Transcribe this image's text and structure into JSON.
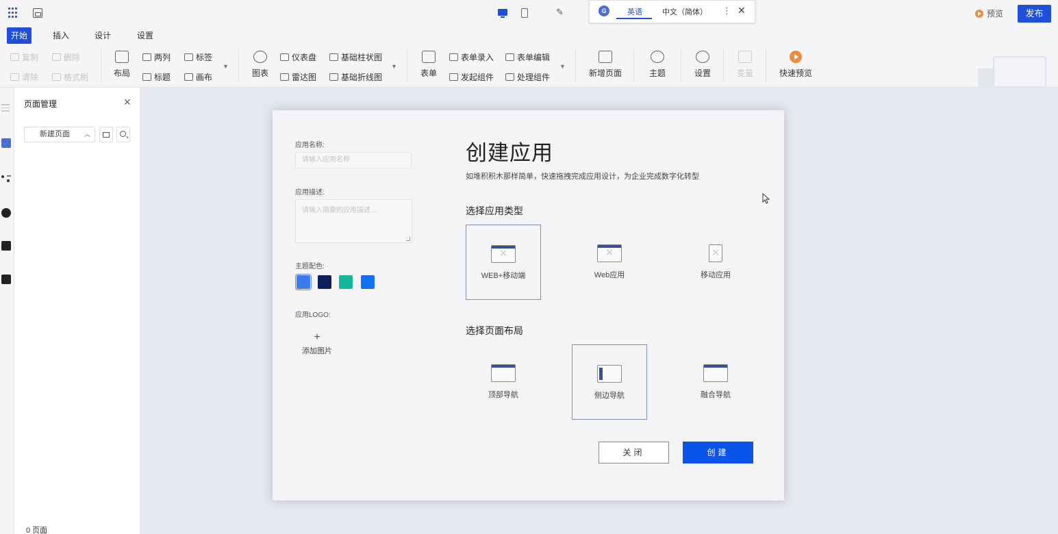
{
  "topbar": {
    "translate": {
      "lang_active": "英语",
      "lang_other": "中文（简体）"
    },
    "preview_label": "预览",
    "publish_label": "发布"
  },
  "menu_tabs": [
    {
      "label": "开始",
      "active": true
    },
    {
      "label": "插入"
    },
    {
      "label": "设计"
    },
    {
      "label": "设置"
    }
  ],
  "ribbon": {
    "edit": {
      "copy": "复制",
      "delete": "删除",
      "clear": "清除",
      "format": "格式刷"
    },
    "layout": {
      "big": "布局",
      "two_col": "两列",
      "tag": "标签",
      "title": "标题",
      "canvas": "画布"
    },
    "charts": {
      "big": "图表",
      "gauge": "仪表盘",
      "bar": "基础柱状图",
      "radar": "雷达图",
      "line": "基础折线图"
    },
    "forms": {
      "big": "表单",
      "entry": "表单录入",
      "edit": "表单编辑",
      "start": "发起组件",
      "process": "处理组件"
    },
    "new_page": "新增页面",
    "theme": "主题",
    "settings": "设置",
    "convert": "变量",
    "quick_preview": "快速预览"
  },
  "panel": {
    "title": "页面管理",
    "new_page_select": "新建页面",
    "footer": "0 页面"
  },
  "modal": {
    "name_label": "应用名称:",
    "name_placeholder": "请输入应用名称",
    "desc_label": "应用描述:",
    "desc_placeholder": "请输入简要的应用描述...",
    "color_label": "主题配色:",
    "colors": [
      "#3b7bf0",
      "#0e1f5a",
      "#14b79a",
      "#1570f5"
    ],
    "logo_label": "应用LOGO:",
    "add_image": "添加图片",
    "title": "创建应用",
    "subtitle": "如堆积积木那样简单，快速拖拽完成应用设计，为企业完成数字化转型",
    "type_section": "选择应用类型",
    "types": [
      {
        "label": "WEB+移动端",
        "icon": "web-mobile-icon",
        "selected": true
      },
      {
        "label": "Web应用",
        "icon": "web-app-icon"
      },
      {
        "label": "移动应用",
        "icon": "mobile-app-icon"
      }
    ],
    "layout_section": "选择页面布局",
    "layouts": [
      {
        "label": "顶部导航",
        "icon": "top-nav-icon"
      },
      {
        "label": "侧边导航",
        "icon": "side-nav-icon",
        "selected": true
      },
      {
        "label": "融合导航",
        "icon": "mixed-nav-icon"
      }
    ],
    "close_label": "关闭",
    "create_label": "创建"
  }
}
